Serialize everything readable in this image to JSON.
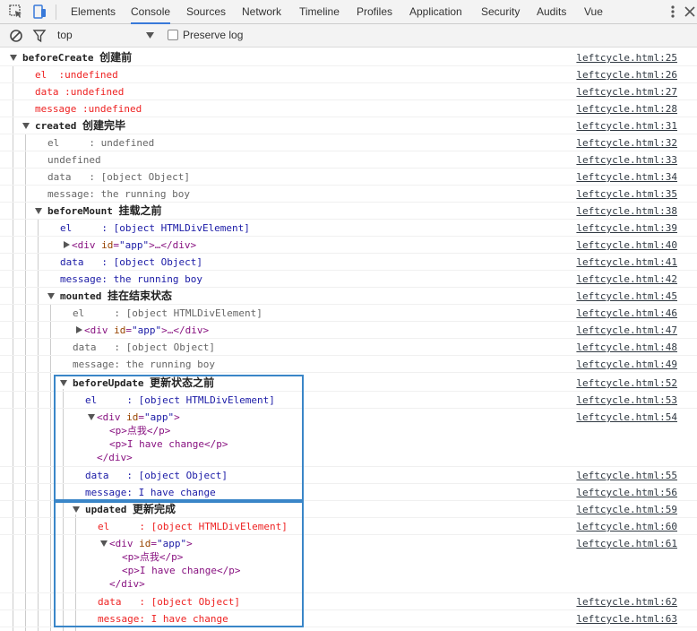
{
  "devtools": {
    "tabs": [
      "Elements",
      "Console",
      "Sources",
      "Network",
      "Timeline",
      "Profiles",
      "Application",
      "Security",
      "Audits",
      "Vue"
    ],
    "active_tab": "Console",
    "context": "top",
    "preserve_log": "Preserve log"
  },
  "console": {
    "beforeCreate": {
      "label": "beforeCreate",
      "cn": "创建前",
      "src": "leftcycle.html:25"
    },
    "bc_el": {
      "text": "el  :undefined",
      "src": "leftcycle.html:26"
    },
    "bc_data": {
      "text": "data :undefined",
      "src": "leftcycle.html:27"
    },
    "bc_msg": {
      "text": "message :undefined",
      "src": "leftcycle.html:28"
    },
    "created": {
      "label": "created",
      "cn": "创建完毕",
      "src": "leftcycle.html:31"
    },
    "cr_el": {
      "text": "el     : undefined",
      "src": "leftcycle.html:32"
    },
    "cr_undef": {
      "text": "undefined",
      "src": "leftcycle.html:33"
    },
    "cr_data": {
      "text": "data   : [object Object]",
      "src": "leftcycle.html:34"
    },
    "cr_msg": {
      "text": "message: the running boy",
      "src": "leftcycle.html:35"
    },
    "beforeMount": {
      "label": "beforeMount",
      "cn": "挂载之前",
      "src": "leftcycle.html:38"
    },
    "bm_el": {
      "text": "el     : [object HTMLDivElement]",
      "src": "leftcycle.html:39"
    },
    "bm_div": {
      "open": "<div ",
      "attr": "id",
      "eq": "=",
      "val": "\"app\"",
      "rest": ">…</div>",
      "src": "leftcycle.html:40"
    },
    "bm_data": {
      "text": "data   : [object Object]",
      "src": "leftcycle.html:41"
    },
    "bm_msg": {
      "text": "message: the running boy",
      "src": "leftcycle.html:42"
    },
    "mounted": {
      "label": "mounted",
      "cn": "挂在结束状态",
      "src": "leftcycle.html:45"
    },
    "mo_el": {
      "text": "el     : [object HTMLDivElement]",
      "src": "leftcycle.html:46"
    },
    "mo_div": {
      "open": "<div ",
      "attr": "id",
      "eq": "=",
      "val": "\"app\"",
      "rest": ">…</div>",
      "src": "leftcycle.html:47"
    },
    "mo_data": {
      "text": "data   : [object Object]",
      "src": "leftcycle.html:48"
    },
    "mo_msg": {
      "text": "message: the running boy",
      "src": "leftcycle.html:49"
    },
    "beforeUpdate": {
      "label": "beforeUpdate",
      "cn": "更新状态之前",
      "src": "leftcycle.html:52"
    },
    "bu_el": {
      "text": "el     : [object HTMLDivElement]",
      "src": "leftcycle.html:53"
    },
    "bu_div": {
      "open": "<div ",
      "attr": "id",
      "eq": "=",
      "val": "\"app\"",
      "close": ">",
      "p1": "<p>点我</p>",
      "p2": "<p>I have change</p>",
      "end": "</div>",
      "src": "leftcycle.html:54"
    },
    "bu_data": {
      "text": "data   : [object Object]",
      "src": "leftcycle.html:55"
    },
    "bu_msg": {
      "text": "message: I have change",
      "src": "leftcycle.html:56"
    },
    "updated": {
      "label": "updated",
      "cn": "更新完成",
      "src": "leftcycle.html:59"
    },
    "up_el": {
      "text": "el     : [object HTMLDivElement]",
      "src": "leftcycle.html:60"
    },
    "up_div": {
      "open": "<div ",
      "attr": "id",
      "eq": "=",
      "val": "\"app\"",
      "close": ">",
      "p1": "<p>点我</p>",
      "p2": "<p>I have change</p>",
      "end": "</div>",
      "src": "leftcycle.html:61"
    },
    "up_data": {
      "text": "data   : [object Object]",
      "src": "leftcycle.html:62"
    },
    "up_msg": {
      "text": "message: I have change",
      "src": "leftcycle.html:63"
    }
  }
}
